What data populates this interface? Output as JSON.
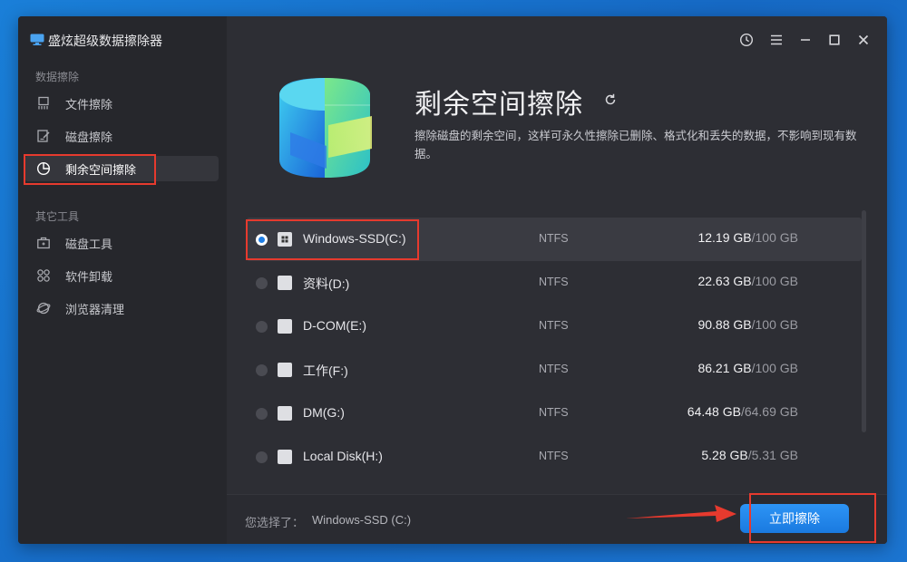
{
  "app": {
    "title": "盛炫超级数据擦除器"
  },
  "window_controls": [
    "history-icon",
    "menu-icon",
    "minimize-icon",
    "maximize-icon",
    "close-icon"
  ],
  "sidebar": {
    "section1_label": "数据擦除",
    "items1": [
      {
        "label": "文件擦除",
        "icon": "file-shred-icon"
      },
      {
        "label": "磁盘擦除",
        "icon": "disk-edit-icon"
      },
      {
        "label": "剩余空间擦除",
        "icon": "pie-chart-icon",
        "active": true
      }
    ],
    "section2_label": "其它工具",
    "items2": [
      {
        "label": "磁盘工具",
        "icon": "toolbox-icon"
      },
      {
        "label": "软件卸载",
        "icon": "apps-grid-icon"
      },
      {
        "label": "浏览器清理",
        "icon": "browser-icon"
      }
    ]
  },
  "main": {
    "heading": "剩余空间擦除",
    "description": "擦除磁盘的剩余空间，这样可永久性擦除已删除、格式化和丢失的数据，不影响到现有数据。"
  },
  "disks": [
    {
      "name": "Windows-SSD(C:)",
      "fs": "NTFS",
      "used": "12.19 GB",
      "total": "/100 GB",
      "selected": true,
      "icon": "windows-drive-icon"
    },
    {
      "name": "资料(D:)",
      "fs": "NTFS",
      "used": "22.63 GB",
      "total": "/100 GB",
      "selected": false,
      "icon": "drive-icon"
    },
    {
      "name": "D-COM(E:)",
      "fs": "NTFS",
      "used": "90.88 GB",
      "total": "/100 GB",
      "selected": false,
      "icon": "drive-icon"
    },
    {
      "name": "工作(F:)",
      "fs": "NTFS",
      "used": "86.21 GB",
      "total": "/100 GB",
      "selected": false,
      "icon": "drive-icon"
    },
    {
      "name": "DM(G:)",
      "fs": "NTFS",
      "used": "64.48 GB",
      "total": "/64.69 GB",
      "selected": false,
      "icon": "drive-icon"
    },
    {
      "name": "Local Disk(H:)",
      "fs": "NTFS",
      "used": "5.28 GB",
      "total": "/5.31 GB",
      "selected": false,
      "icon": "drive-icon"
    }
  ],
  "footer": {
    "selected_label": "您选择了：",
    "selected_value": "Windows-SSD (C:)",
    "erase_button": "立即擦除"
  },
  "colors": {
    "accent": "#1f7fe6",
    "highlight": "#e63a2e",
    "background": "#2a2b31"
  }
}
